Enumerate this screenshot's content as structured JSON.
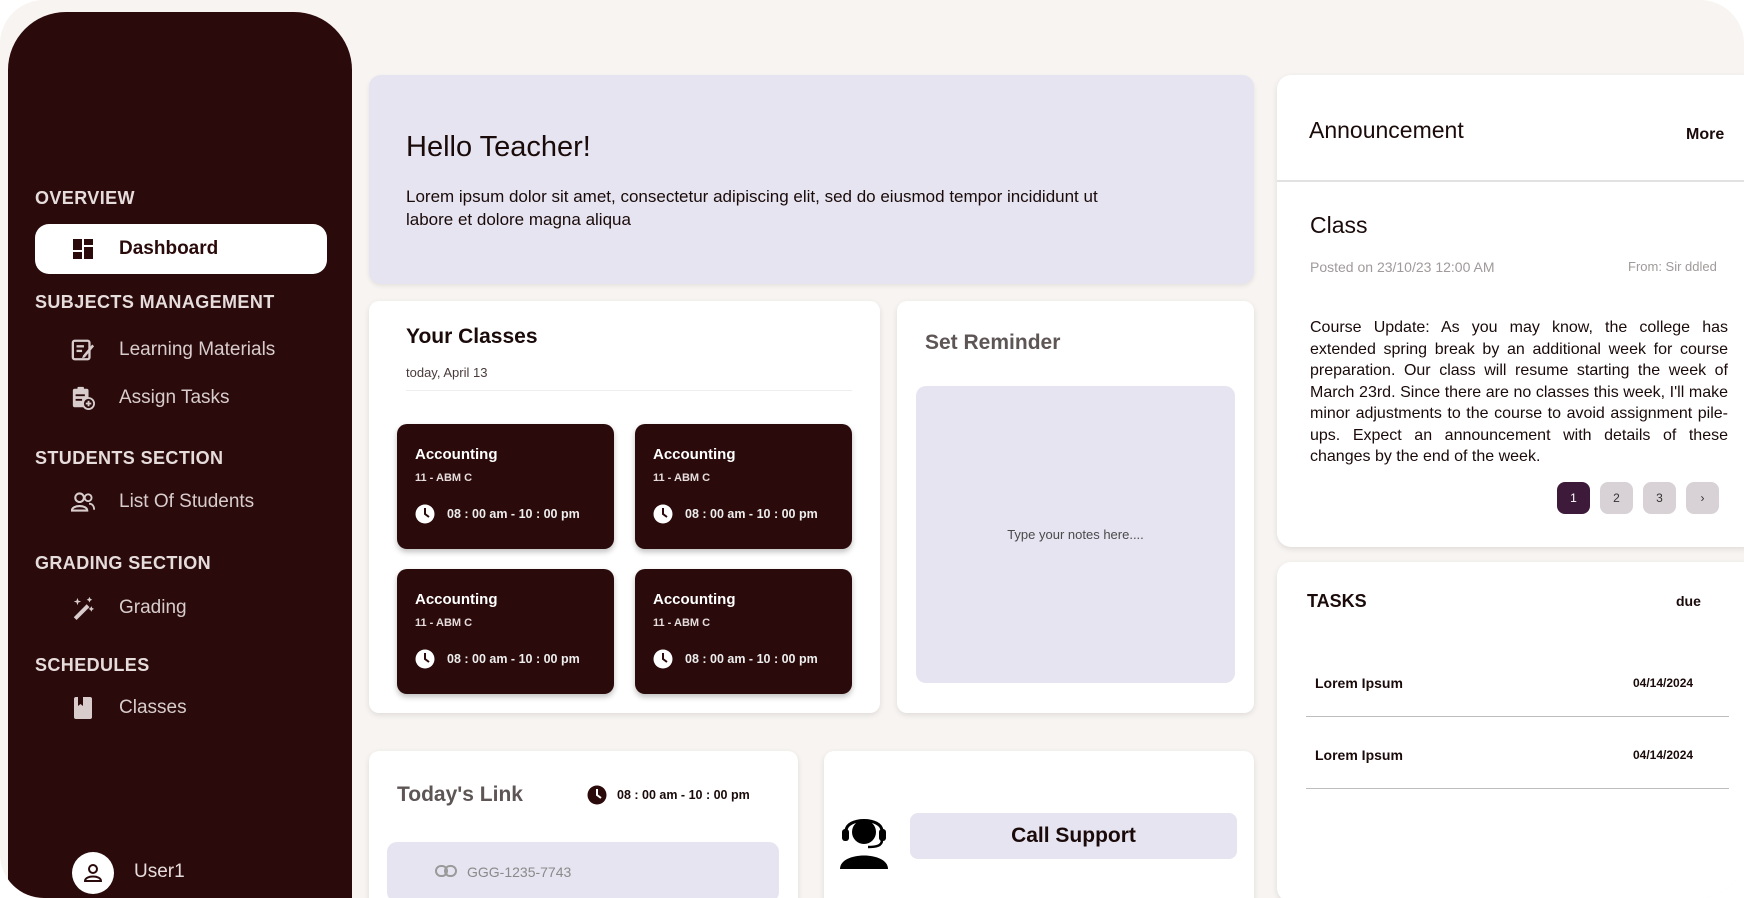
{
  "sidebar": {
    "sections": {
      "overview": "OVERVIEW",
      "subjects": "SUBJECTS MANAGEMENT",
      "students": "STUDENTS SECTION",
      "grading": "GRADING SECTION",
      "schedules": "SCHEDULES"
    },
    "items": {
      "dashboard": "Dashboard",
      "learning_materials": "Learning Materials",
      "assign_tasks": "Assign Tasks",
      "list_of_students": "List Of Students",
      "grading": "Grading",
      "classes": "Classes"
    },
    "user": "User1"
  },
  "hello": {
    "title": "Hello Teacher!",
    "text": "Lorem ipsum dolor sit amet, consectetur adipiscing elit, sed do eiusmod tempor incididunt ut labore et dolore magna aliqua"
  },
  "your_classes": {
    "title": "Your Classes",
    "date": "today, April 13",
    "items": [
      {
        "name": "Accounting",
        "section": "11 - ABM C",
        "time": "08 : 00 am - 10 : 00 pm"
      },
      {
        "name": "Accounting",
        "section": "11 - ABM C",
        "time": "08 : 00 am - 10 : 00 pm"
      },
      {
        "name": "Accounting",
        "section": "11 - ABM C",
        "time": "08 : 00 am - 10 : 00 pm"
      },
      {
        "name": "Accounting",
        "section": "11 - ABM C",
        "time": "08 : 00 am - 10 : 00 pm"
      }
    ]
  },
  "reminder": {
    "title": "Set Reminder",
    "placeholder": "Type your notes here...."
  },
  "todays_link": {
    "title": "Today's Link",
    "time": "08 : 00 am - 10 : 00 pm",
    "code": "GGG-1235-7743"
  },
  "support": {
    "button": "Call Support"
  },
  "announcement": {
    "title": "Announcement",
    "more": "More",
    "heading": "Class",
    "posted": "Posted on 23/10/23  12:00 AM",
    "from": "From: Sir ddled",
    "body": "Course Update: As you may know, the college has extended spring break by an additional week for course preparation. Our class will resume starting the week of March 23rd. Since there are no classes this week, I'll make minor adjustments to the course to avoid assignment pile-ups. Expect an announcement with details of these changes by the end of the week.",
    "pages": [
      "1",
      "2",
      "3",
      "›"
    ]
  },
  "tasks": {
    "title": "TASKS",
    "due_label": "due",
    "items": [
      {
        "name": "Lorem Ipsum",
        "due": "04/14/2024"
      },
      {
        "name": "Lorem Ipsum",
        "due": "04/14/2024"
      }
    ]
  },
  "colors": {
    "sidebar": "#2a0a0a",
    "accent_panel": "#e5e4f0",
    "page_active": "#3e1a3a"
  }
}
